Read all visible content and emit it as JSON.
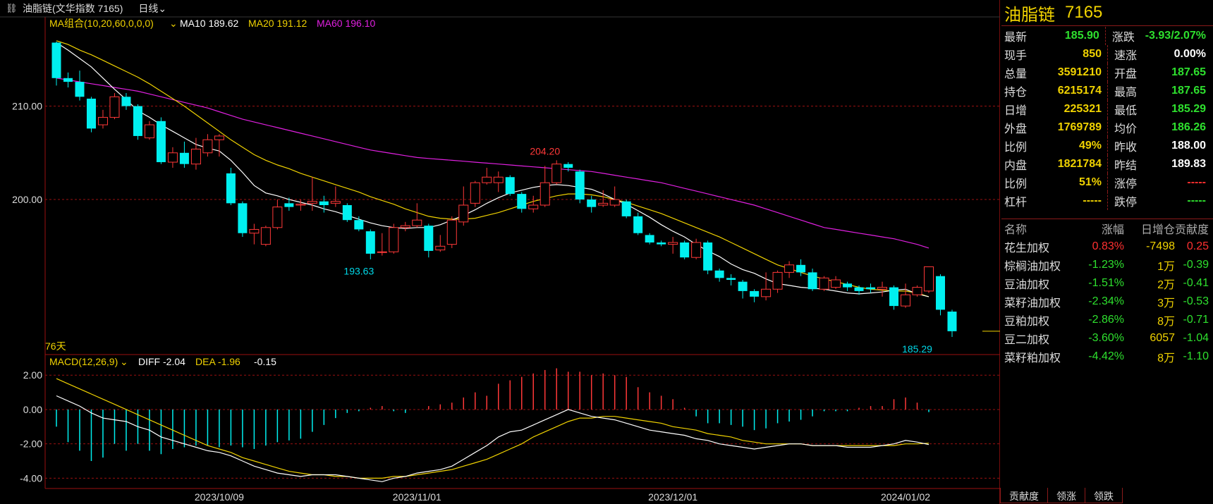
{
  "header": {
    "link_icon": "link-icon",
    "title": "油脂链(文华指数 7165)",
    "period": "日线"
  },
  "main_legend": {
    "ma_group": "MA组合(10,20,60,0,0,0)",
    "ma10": "MA10 189.62",
    "ma20": "MA20 191.12",
    "ma60": "MA60 196.10"
  },
  "macd_legend": {
    "label": "MACD(12,26,9)",
    "diff": "DIFF -2.04",
    "dea": "DEA -1.96",
    "macd": "-0.15"
  },
  "days_label": "76天",
  "colors": {
    "up": "#ff3838",
    "down": "#00f0f0",
    "ma10": "#ffffff",
    "ma20": "#f0d200",
    "ma60": "#e020e0",
    "grid": "#9a1010"
  },
  "chart_data": {
    "type": "candlestick",
    "price_axis": {
      "ticks": [
        210.0,
        200.0
      ],
      "ylim": [
        183.4,
        219.4
      ]
    },
    "macd_axis": {
      "ticks": [
        "2.00",
        "0.00",
        "-2.00",
        "-4.00"
      ],
      "ylim": [
        -4.6,
        3.2
      ]
    },
    "date_labels": [
      {
        "label": "2023/10/09",
        "index": 14
      },
      {
        "label": "2023/11/01",
        "index": 31
      },
      {
        "label": "2023/12/01",
        "index": 53
      },
      {
        "label": "2024/01/02",
        "index": 73
      }
    ],
    "annotations": [
      {
        "text": "204.20",
        "index": 42,
        "value": 204.2,
        "kind": "high"
      },
      {
        "text": "193.63",
        "index": 26,
        "value": 193.63,
        "kind": "low"
      },
      {
        "text": "185.29",
        "index": 74,
        "value": 185.29,
        "kind": "low"
      }
    ],
    "candles": [
      [
        216.8,
        213.0,
        216.9,
        212.2
      ],
      [
        213.0,
        212.6,
        213.6,
        212.0
      ],
      [
        212.6,
        211.0,
        213.8,
        210.6
      ],
      [
        210.8,
        207.6,
        211.0,
        207.2
      ],
      [
        208.0,
        208.8,
        209.6,
        207.6
      ],
      [
        208.8,
        211.0,
        211.4,
        208.6
      ],
      [
        211.0,
        210.0,
        211.4,
        209.6
      ],
      [
        210.0,
        206.8,
        210.2,
        206.4
      ],
      [
        206.6,
        208.0,
        208.4,
        206.4
      ],
      [
        208.4,
        204.0,
        208.8,
        203.8
      ],
      [
        204.0,
        205.0,
        205.6,
        203.4
      ],
      [
        205.0,
        203.8,
        206.2,
        203.4
      ],
      [
        203.8,
        205.4,
        206.6,
        203.2
      ],
      [
        205.0,
        206.4,
        207.0,
        204.6
      ],
      [
        206.4,
        206.8,
        207.0,
        204.6
      ],
      [
        202.8,
        199.6,
        203.4,
        199.4
      ],
      [
        199.6,
        196.4,
        199.8,
        196.0
      ],
      [
        196.4,
        196.8,
        197.4,
        195.2
      ],
      [
        195.2,
        197.0,
        197.2,
        195.0
      ],
      [
        197.0,
        199.2,
        200.0,
        196.8
      ],
      [
        199.6,
        199.2,
        200.2,
        198.8
      ],
      [
        199.4,
        199.5,
        200.0,
        198.8
      ],
      [
        199.6,
        199.8,
        202.4,
        198.8
      ],
      [
        199.8,
        199.4,
        200.4,
        198.6
      ],
      [
        199.6,
        199.8,
        201.4,
        199.2
      ],
      [
        199.4,
        197.8,
        199.6,
        197.6
      ],
      [
        197.8,
        196.8,
        198.2,
        196.6
      ],
      [
        196.6,
        194.2,
        196.8,
        193.6
      ],
      [
        194.4,
        194.4,
        196.4,
        194.0
      ],
      [
        194.4,
        197.0,
        197.4,
        194.2
      ],
      [
        197.0,
        197.2,
        197.6,
        196.6
      ],
      [
        197.2,
        197.8,
        199.6,
        197.0
      ],
      [
        197.2,
        194.5,
        197.4,
        193.8
      ],
      [
        194.6,
        195.0,
        196.2,
        194.4
      ],
      [
        195.2,
        197.8,
        198.2,
        194.8
      ],
      [
        197.6,
        199.4,
        201.4,
        197.2
      ],
      [
        199.6,
        201.8,
        202.0,
        199.2
      ],
      [
        201.8,
        202.4,
        203.4,
        201.6
      ],
      [
        201.8,
        202.4,
        203.0,
        200.8
      ],
      [
        202.4,
        200.6,
        202.6,
        200.4
      ],
      [
        200.6,
        199.0,
        200.8,
        198.6
      ],
      [
        199.0,
        199.4,
        200.4,
        198.6
      ],
      [
        199.4,
        201.8,
        203.6,
        199.2
      ],
      [
        201.8,
        203.8,
        204.2,
        201.6
      ],
      [
        203.8,
        203.4,
        204.0,
        203.0
      ],
      [
        203.0,
        200.0,
        203.2,
        199.6
      ],
      [
        200.0,
        199.2,
        200.4,
        198.6
      ],
      [
        199.4,
        199.6,
        201.0,
        199.2
      ],
      [
        199.4,
        200.0,
        201.4,
        199.2
      ],
      [
        199.8,
        198.2,
        200.0,
        198.0
      ],
      [
        198.2,
        196.4,
        198.6,
        196.2
      ],
      [
        196.2,
        195.4,
        196.4,
        195.2
      ],
      [
        195.4,
        195.2,
        195.6,
        195.0
      ],
      [
        195.2,
        195.4,
        196.0,
        194.2
      ],
      [
        195.4,
        193.8,
        195.6,
        193.6
      ],
      [
        193.8,
        195.4,
        195.8,
        193.6
      ],
      [
        195.4,
        192.4,
        195.6,
        192.0
      ],
      [
        192.4,
        191.6,
        192.6,
        191.2
      ],
      [
        191.6,
        191.4,
        192.0,
        190.8
      ],
      [
        191.2,
        190.2,
        191.4,
        189.4
      ],
      [
        190.2,
        189.6,
        190.4,
        189.0
      ],
      [
        189.6,
        190.4,
        192.2,
        189.2
      ],
      [
        190.4,
        192.2,
        192.4,
        190.0
      ],
      [
        192.2,
        193.0,
        193.4,
        191.6
      ],
      [
        193.0,
        192.2,
        193.6,
        191.8
      ],
      [
        192.2,
        190.4,
        192.6,
        190.2
      ],
      [
        190.4,
        191.6,
        191.8,
        190.2
      ],
      [
        190.6,
        191.4,
        191.8,
        190.4
      ],
      [
        191.0,
        190.6,
        191.2,
        190.2
      ],
      [
        190.6,
        190.2,
        190.8,
        189.8
      ],
      [
        190.6,
        190.4,
        191.0,
        190.0
      ],
      [
        190.4,
        190.6,
        191.2,
        189.6
      ],
      [
        190.6,
        188.6,
        190.8,
        188.2
      ],
      [
        188.6,
        189.8,
        191.0,
        188.4
      ],
      [
        189.8,
        190.6,
        190.8,
        189.6
      ],
      [
        190.2,
        192.8,
        192.8,
        190.0
      ],
      [
        191.8,
        188.2,
        192.0,
        187.6
      ],
      [
        188.0,
        185.9,
        188.2,
        185.29
      ]
    ],
    "ma10": [
      216.8,
      216.0,
      215.1,
      214.2,
      213.0,
      211.8,
      210.7,
      209.5,
      208.8,
      208.0,
      207.3,
      206.6,
      205.9,
      205.5,
      205.2,
      204.2,
      202.9,
      201.5,
      200.7,
      200.4,
      200.0,
      199.7,
      199.4,
      199.0,
      198.7,
      198.3,
      197.9,
      197.5,
      197.2,
      197.0,
      196.9,
      197.0,
      197.0,
      197.3,
      197.8,
      198.3,
      198.9,
      199.6,
      200.2,
      200.7,
      201.0,
      201.3,
      201.5,
      201.6,
      201.5,
      201.3,
      201.1,
      200.6,
      200.0,
      199.5,
      198.8,
      198.1,
      197.3,
      196.6,
      196.0,
      195.2,
      194.5,
      193.9,
      193.1,
      192.5,
      192.1,
      191.5,
      191.0,
      190.8,
      190.6,
      190.5,
      190.4,
      190.2,
      190.0,
      189.9,
      190.0,
      190.1,
      190.3,
      190.4,
      189.9,
      189.6
    ],
    "ma20": [
      217.0,
      216.6,
      216.0,
      215.5,
      214.9,
      214.3,
      213.7,
      213.1,
      212.4,
      211.6,
      210.8,
      210.0,
      209.1,
      208.2,
      207.3,
      206.4,
      205.6,
      204.8,
      204.2,
      203.7,
      203.3,
      202.8,
      202.4,
      202.0,
      201.6,
      201.2,
      200.8,
      200.3,
      199.9,
      199.5,
      199.0,
      198.6,
      198.2,
      198.0,
      197.9,
      197.9,
      198.0,
      198.3,
      198.6,
      199.0,
      199.4,
      199.8,
      200.1,
      200.4,
      200.6,
      200.6,
      200.5,
      200.3,
      200.0,
      199.7,
      199.3,
      198.9,
      198.5,
      198.0,
      197.5,
      197.0,
      196.5,
      196.0,
      195.4,
      194.8,
      194.2,
      193.6,
      193.0,
      192.6,
      192.2,
      191.8,
      191.5,
      191.2,
      190.9,
      190.6,
      190.4,
      190.3,
      190.2,
      190.2,
      190.0,
      189.6
    ],
    "ma60": [
      213.0,
      212.8,
      212.6,
      212.4,
      212.2,
      212.0,
      211.8,
      211.6,
      211.3,
      211.0,
      210.7,
      210.4,
      210.1,
      209.8,
      209.4,
      209.0,
      208.6,
      208.3,
      208.0,
      207.7,
      207.4,
      207.1,
      206.8,
      206.5,
      206.2,
      205.9,
      205.6,
      205.3,
      205.1,
      204.9,
      204.7,
      204.5,
      204.4,
      204.3,
      204.2,
      204.1,
      204.0,
      203.9,
      203.8,
      203.7,
      203.6,
      203.5,
      203.4,
      203.3,
      203.2,
      203.1,
      203.0,
      202.8,
      202.6,
      202.4,
      202.2,
      202.0,
      201.8,
      201.5,
      201.2,
      200.9,
      200.6,
      200.3,
      200.0,
      199.7,
      199.4,
      199.0,
      198.6,
      198.2,
      197.8,
      197.4,
      197.0,
      196.8,
      196.6,
      196.4,
      196.2,
      196.0,
      195.8,
      195.5,
      195.2,
      194.8
    ],
    "diff": [
      0.8,
      0.5,
      0.2,
      -0.2,
      -0.5,
      -0.6,
      -0.7,
      -1.0,
      -1.2,
      -1.6,
      -1.8,
      -2.0,
      -2.2,
      -2.4,
      -2.5,
      -2.7,
      -3.0,
      -3.3,
      -3.5,
      -3.7,
      -3.8,
      -3.9,
      -3.8,
      -3.8,
      -3.8,
      -3.9,
      -4.0,
      -4.1,
      -4.2,
      -4.0,
      -3.9,
      -3.7,
      -3.6,
      -3.5,
      -3.3,
      -2.9,
      -2.5,
      -2.1,
      -1.6,
      -1.3,
      -1.2,
      -0.9,
      -0.6,
      -0.3,
      0.0,
      -0.2,
      -0.4,
      -0.5,
      -0.6,
      -0.8,
      -1.0,
      -1.2,
      -1.3,
      -1.4,
      -1.5,
      -1.7,
      -1.8,
      -2.0,
      -2.1,
      -2.2,
      -2.3,
      -2.2,
      -2.1,
      -2.0,
      -2.0,
      -2.1,
      -2.1,
      -2.1,
      -2.2,
      -2.2,
      -2.2,
      -2.1,
      -2.0,
      -1.8,
      -1.9,
      -2.04
    ],
    "dea": [
      1.8,
      1.5,
      1.2,
      0.9,
      0.6,
      0.3,
      0.0,
      -0.3,
      -0.6,
      -0.9,
      -1.2,
      -1.5,
      -1.8,
      -2.1,
      -2.3,
      -2.5,
      -2.8,
      -3.0,
      -3.2,
      -3.4,
      -3.6,
      -3.7,
      -3.8,
      -3.8,
      -3.9,
      -3.9,
      -4.0,
      -4.0,
      -4.0,
      -3.9,
      -3.9,
      -3.8,
      -3.7,
      -3.6,
      -3.5,
      -3.3,
      -3.1,
      -2.9,
      -2.6,
      -2.3,
      -2.0,
      -1.6,
      -1.3,
      -1.0,
      -0.7,
      -0.5,
      -0.5,
      -0.4,
      -0.4,
      -0.5,
      -0.6,
      -0.7,
      -0.8,
      -1.0,
      -1.1,
      -1.2,
      -1.4,
      -1.5,
      -1.6,
      -1.8,
      -1.9,
      -2.0,
      -2.0,
      -2.0,
      -2.0,
      -2.1,
      -2.1,
      -2.1,
      -2.1,
      -2.1,
      -2.1,
      -2.1,
      -2.1,
      -2.0,
      -2.0,
      -1.96
    ],
    "hist": [
      -1.0,
      -1.9,
      -2.4,
      -3.0,
      -2.8,
      -2.0,
      -2.4,
      -2.0,
      -2.4,
      -2.6,
      -2.3,
      -2.2,
      -2.1,
      -2.1,
      -2.2,
      -2.1,
      -2.2,
      -2.3,
      -2.1,
      -1.9,
      -1.8,
      -1.7,
      -1.3,
      -0.9,
      -0.5,
      -0.2,
      -0.1,
      0.1,
      0.2,
      -0.1,
      -0.2,
      0.0,
      0.2,
      0.3,
      0.4,
      0.7,
      1.0,
      0.8,
      1.5,
      1.7,
      1.9,
      2.1,
      2.3,
      2.4,
      2.2,
      2.2,
      2.0,
      2.1,
      2.0,
      1.9,
      1.3,
      1.0,
      0.8,
      0.6,
      0.1,
      -0.4,
      -0.8,
      -0.8,
      -0.9,
      -1.0,
      -1.2,
      -1.1,
      -0.8,
      -0.7,
      -0.6,
      -0.4,
      -0.1,
      -0.1,
      -0.1,
      0.1,
      0.2,
      0.2,
      0.6,
      0.7,
      0.4,
      -0.15
    ]
  },
  "quote": {
    "name": "油脂链",
    "code": "7165",
    "rows": [
      {
        "l1": "最新",
        "v1": "185.90",
        "c1": "green",
        "l2": "涨跌",
        "v2": "-3.93/2.07%",
        "c2": "green"
      },
      {
        "l1": "现手",
        "v1": "850",
        "c1": "yellow",
        "l2": "速涨",
        "v2": "0.00%",
        "c2": "white"
      },
      {
        "l1": "总量",
        "v1": "3591210",
        "c1": "yellow",
        "l2": "开盘",
        "v2": "187.65",
        "c2": "green"
      },
      {
        "l1": "持仓",
        "v1": "6215174",
        "c1": "yellow",
        "l2": "最高",
        "v2": "187.65",
        "c2": "green"
      },
      {
        "l1": "日增",
        "v1": "225321",
        "c1": "yellow",
        "l2": "最低",
        "v2": "185.29",
        "c2": "green"
      },
      {
        "l1": "外盘",
        "v1": "1769789",
        "c1": "yellow",
        "l2": "均价",
        "v2": "186.26",
        "c2": "green"
      },
      {
        "l1": "比例",
        "v1": "49%",
        "c1": "yellow",
        "l2": "昨收",
        "v2": "188.00",
        "c2": "white"
      },
      {
        "l1": "内盘",
        "v1": "1821784",
        "c1": "yellow",
        "l2": "昨结",
        "v2": "189.83",
        "c2": "white"
      },
      {
        "l1": "比例",
        "v1": "51%",
        "c1": "yellow",
        "l2": "涨停",
        "v2": "-----",
        "c2": "red"
      },
      {
        "l1": "杠杆",
        "v1": "-----",
        "c1": "yellow",
        "l2": "跌停",
        "v2": "-----",
        "c2": "green"
      }
    ]
  },
  "contrib": {
    "headers": [
      "名称",
      "涨幅",
      "日增仓",
      "贡献度"
    ],
    "rows": [
      {
        "name": "花生加权",
        "chg": "0.83%",
        "cc": "red",
        "inc": "-7498",
        "ic": "yellow",
        "con": "0.25",
        "ct": "red"
      },
      {
        "name": "棕榈油加权",
        "chg": "-1.23%",
        "cc": "green",
        "inc": "1万",
        "ic": "yellow",
        "con": "-0.39",
        "ct": "green"
      },
      {
        "name": "豆油加权",
        "chg": "-1.51%",
        "cc": "green",
        "inc": "2万",
        "ic": "yellow",
        "con": "-0.41",
        "ct": "green"
      },
      {
        "name": "菜籽油加权",
        "chg": "-2.34%",
        "cc": "green",
        "inc": "3万",
        "ic": "yellow",
        "con": "-0.53",
        "ct": "green"
      },
      {
        "name": "豆粕加权",
        "chg": "-2.86%",
        "cc": "green",
        "inc": "8万",
        "ic": "yellow",
        "con": "-0.71",
        "ct": "green"
      },
      {
        "name": "豆二加权",
        "chg": "-3.60%",
        "cc": "green",
        "inc": "6057",
        "ic": "yellow",
        "con": "-1.04",
        "ct": "green"
      },
      {
        "name": "菜籽粕加权",
        "chg": "-4.42%",
        "cc": "green",
        "inc": "8万",
        "ic": "yellow",
        "con": "-1.10",
        "ct": "green"
      }
    ]
  },
  "tabs": [
    "贡献度",
    "领涨",
    "领跌"
  ]
}
